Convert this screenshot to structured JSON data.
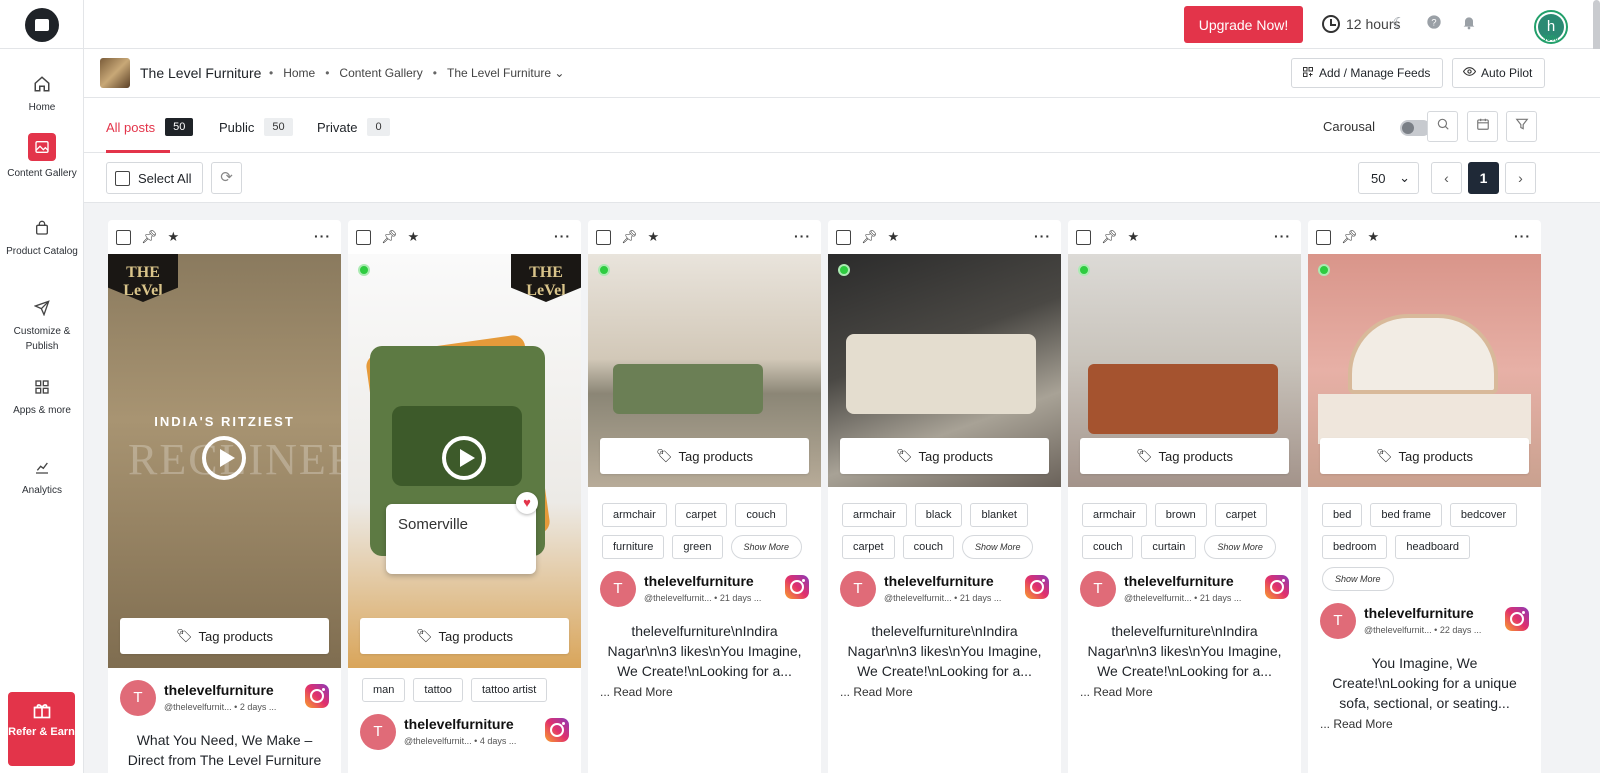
{
  "rail": {
    "items": [
      {
        "label": "Home"
      },
      {
        "label": "Content Gallery"
      },
      {
        "label": "Product Catalog"
      },
      {
        "label": "Customize & Publish"
      },
      {
        "label": "Apps & more"
      },
      {
        "label": "Analytics"
      }
    ],
    "refer": "Refer & Earn"
  },
  "topbar": {
    "upgrade": "Upgrade Now!",
    "hours": "12 hours",
    "avatar_letter": "h",
    "avatar_pct": "30%"
  },
  "subhead": {
    "brand": "The Level Furniture",
    "crumbs": [
      "Home",
      "Content Gallery",
      "The Level Furniture"
    ],
    "add_manage": "Add / Manage Feeds",
    "auto_pilot": "Auto Pilot"
  },
  "tabs": {
    "all": {
      "label": "All posts",
      "count": "50"
    },
    "public": {
      "label": "Public",
      "count": "50"
    },
    "private": {
      "label": "Private",
      "count": "0"
    },
    "carousal": "Carousal"
  },
  "toolbar": {
    "select_all": "Select All",
    "per_page": "50",
    "page": "1"
  },
  "cards": [
    {
      "badge": "LeVel",
      "overlay_text": "INDIA'S RITZIEST",
      "tag_btn": "Tag products",
      "tags": [],
      "show_more": "",
      "user": "thelevelfurniture",
      "handle": "@thelevelfurnit... • 2 days ...",
      "avatar": "T",
      "caption": "What You Need, We Make – Direct from The Level Furniture",
      "read_more": ""
    },
    {
      "badge": "LeVel",
      "overlay_text": "Somerville",
      "tag_btn": "Tag products",
      "tags": [
        "man",
        "tattoo",
        "tattoo artist"
      ],
      "show_more": "",
      "user": "thelevelfurniture",
      "handle": "@thelevelfurnit... • 4 days ...",
      "avatar": "T",
      "caption": "",
      "read_more": ""
    },
    {
      "badge": "",
      "overlay_text": "",
      "tag_btn": "Tag products",
      "tags": [
        "armchair",
        "carpet",
        "couch",
        "furniture",
        "green"
      ],
      "show_more": "Show More",
      "user": "thelevelfurniture",
      "handle": "@thelevelfurnit... • 21 days ...",
      "avatar": "T",
      "caption": "thelevelfurniture\\nIndira Nagar\\n\\n3 likes\\nYou Imagine, We Create!\\nLooking for a...",
      "read_more": "... Read More"
    },
    {
      "badge": "",
      "overlay_text": "",
      "tag_btn": "Tag products",
      "tags": [
        "armchair",
        "black",
        "blanket",
        "carpet",
        "couch"
      ],
      "show_more": "Show More",
      "user": "thelevelfurniture",
      "handle": "@thelevelfurnit... • 21 days ...",
      "avatar": "T",
      "caption": "thelevelfurniture\\nIndira Nagar\\n\\n3 likes\\nYou Imagine, We Create!\\nLooking for a...",
      "read_more": "... Read More"
    },
    {
      "badge": "",
      "overlay_text": "",
      "tag_btn": "Tag products",
      "tags": [
        "armchair",
        "brown",
        "carpet",
        "couch",
        "curtain"
      ],
      "show_more": "Show More",
      "user": "thelevelfurniture",
      "handle": "@thelevelfurnit... • 21 days ...",
      "avatar": "T",
      "caption": "thelevelfurniture\\nIndira Nagar\\n\\n3 likes\\nYou Imagine, We Create!\\nLooking for a...",
      "read_more": "... Read More"
    },
    {
      "badge": "",
      "overlay_text": "",
      "tag_btn": "Tag products",
      "tags": [
        "bed",
        "bed frame",
        "bedcover",
        "bedroom",
        "headboard"
      ],
      "show_more": "Show More",
      "user": "thelevelfurniture",
      "handle": "@thelevelfurnit... • 22 days ...",
      "avatar": "T",
      "caption": "You Imagine, We Create!\\nLooking for a unique sofa, sectional, or seating...",
      "read_more": "... Read More"
    }
  ],
  "colors": {
    "accent": "#e3344a",
    "dark": "#1f2937"
  }
}
